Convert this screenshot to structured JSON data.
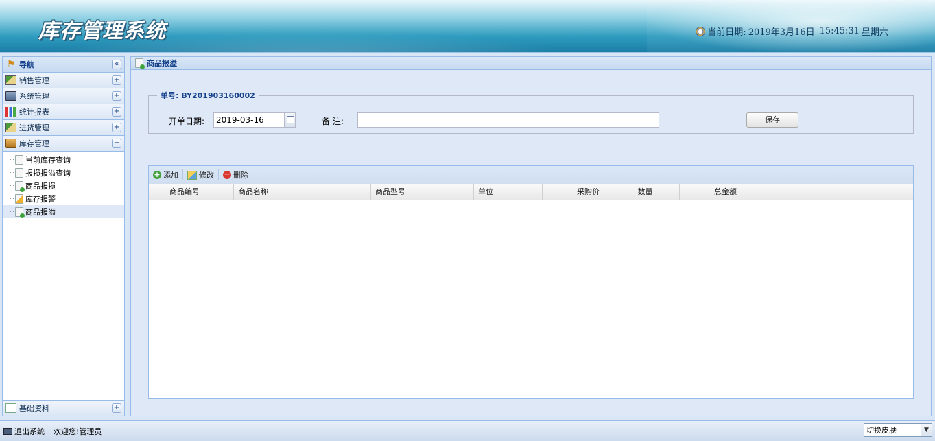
{
  "header": {
    "app_title": "库存管理系统",
    "date_label": "当前日期:",
    "date_value": "2019年3月16日",
    "time_value": "15:45:31",
    "weekday": "星期六"
  },
  "nav": {
    "title": "导航",
    "collapse_glyph": "«",
    "sections": [
      {
        "label": "销售管理",
        "icon": "sales-icon",
        "toggle": "+"
      },
      {
        "label": "系统管理",
        "icon": "system-icon",
        "toggle": "+"
      },
      {
        "label": "统计报表",
        "icon": "chart-icon",
        "toggle": "+"
      },
      {
        "label": "进货管理",
        "icon": "purchase-icon",
        "toggle": "+"
      },
      {
        "label": "库存管理",
        "icon": "inventory-icon",
        "toggle": "−"
      }
    ],
    "tree_items": [
      {
        "label": "当前库存查询",
        "icon": "document-icon"
      },
      {
        "label": "报损报溢查询",
        "icon": "document-search-icon"
      },
      {
        "label": "商品报损",
        "icon": "document-minus-icon"
      },
      {
        "label": "库存报警",
        "icon": "warning-icon"
      },
      {
        "label": "商品报溢",
        "icon": "document-plus-icon",
        "selected": true
      }
    ],
    "bottom_section": {
      "label": "基础资料",
      "icon": "base-data-icon",
      "toggle": "+"
    }
  },
  "main": {
    "panel_title": "商品报溢",
    "form": {
      "legend": "单号: BY201903160002",
      "date_label": "开单日期:",
      "date_value": "2019-03-16",
      "remark_label": "备  注:",
      "remark_value": "",
      "save_label": "保存"
    },
    "toolbar": {
      "add_label": "添加",
      "edit_label": "修改",
      "delete_label": "删除"
    },
    "grid_columns": [
      "",
      "商品编号",
      "商品名称",
      "商品型号",
      "单位",
      "采购价",
      "数量",
      "总金额"
    ],
    "grid_rows": []
  },
  "footer": {
    "logout_label": "退出系统",
    "welcome_label": "欢迎您!管理员",
    "skin_selected": "切换皮肤"
  }
}
